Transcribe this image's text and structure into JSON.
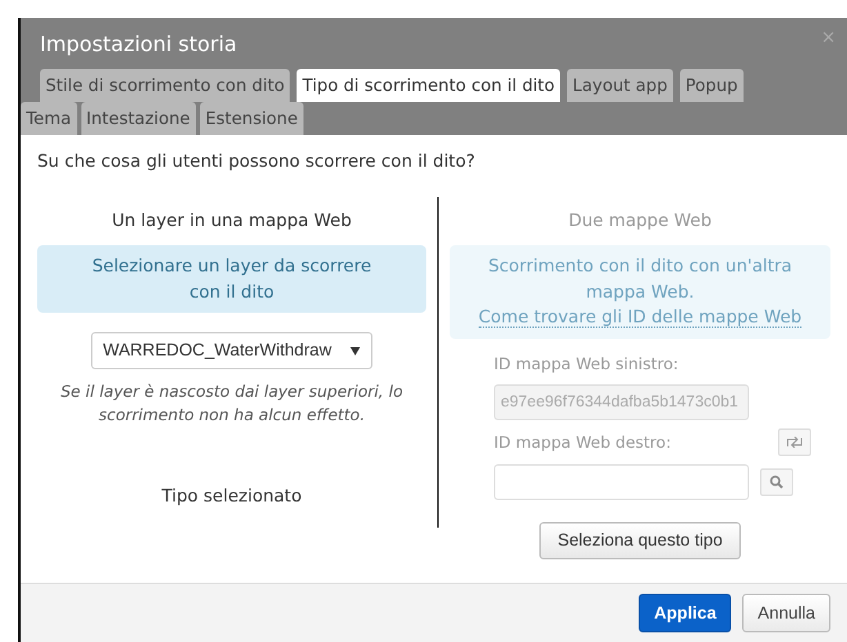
{
  "window": {
    "title": "Impostazioni storia",
    "close": "×"
  },
  "tab_rows": [
    [
      {
        "label": "Stile di scorrimento con dito",
        "selected": false
      },
      {
        "label": "Tipo di scorrimento con il dito",
        "selected": true
      },
      {
        "label": "Layout app",
        "selected": false
      },
      {
        "label": "Popup",
        "selected": false
      }
    ],
    [
      {
        "label": "Tema",
        "selected": false
      },
      {
        "label": "Intestazione",
        "selected": false
      },
      {
        "label": "Estensione",
        "selected": false
      }
    ]
  ],
  "question": "Su che cosa gli utenti possono scorrere con il dito?",
  "left_option": {
    "heading": "Un layer in una mappa Web",
    "disabled": false,
    "info": "Selezionare un layer da scorrere con il dito",
    "layer_select": {
      "value": "WARREDOC_WaterWithdraw"
    },
    "note": "Se il layer è nascosto dai layer superiori, lo scorrimento non ha alcun effetto.",
    "status": "Tipo selezionato"
  },
  "right_option": {
    "heading": "Due mappe Web",
    "disabled": true,
    "info": "Scorrimento con il dito con un'altra mappa Web.",
    "info_link": "Come trovare gli ID delle mappe Web",
    "left_label": "ID mappa Web sinistro:",
    "left_value": "e97ee96f76344dafba5b1473c0b1",
    "right_label": "ID mappa Web destro:",
    "button": "Seleziona questo tipo"
  },
  "buttons": [
    {
      "label": "Applica",
      "kind": "primary"
    },
    {
      "label": "Annulla",
      "kind": "secondary"
    }
  ]
}
